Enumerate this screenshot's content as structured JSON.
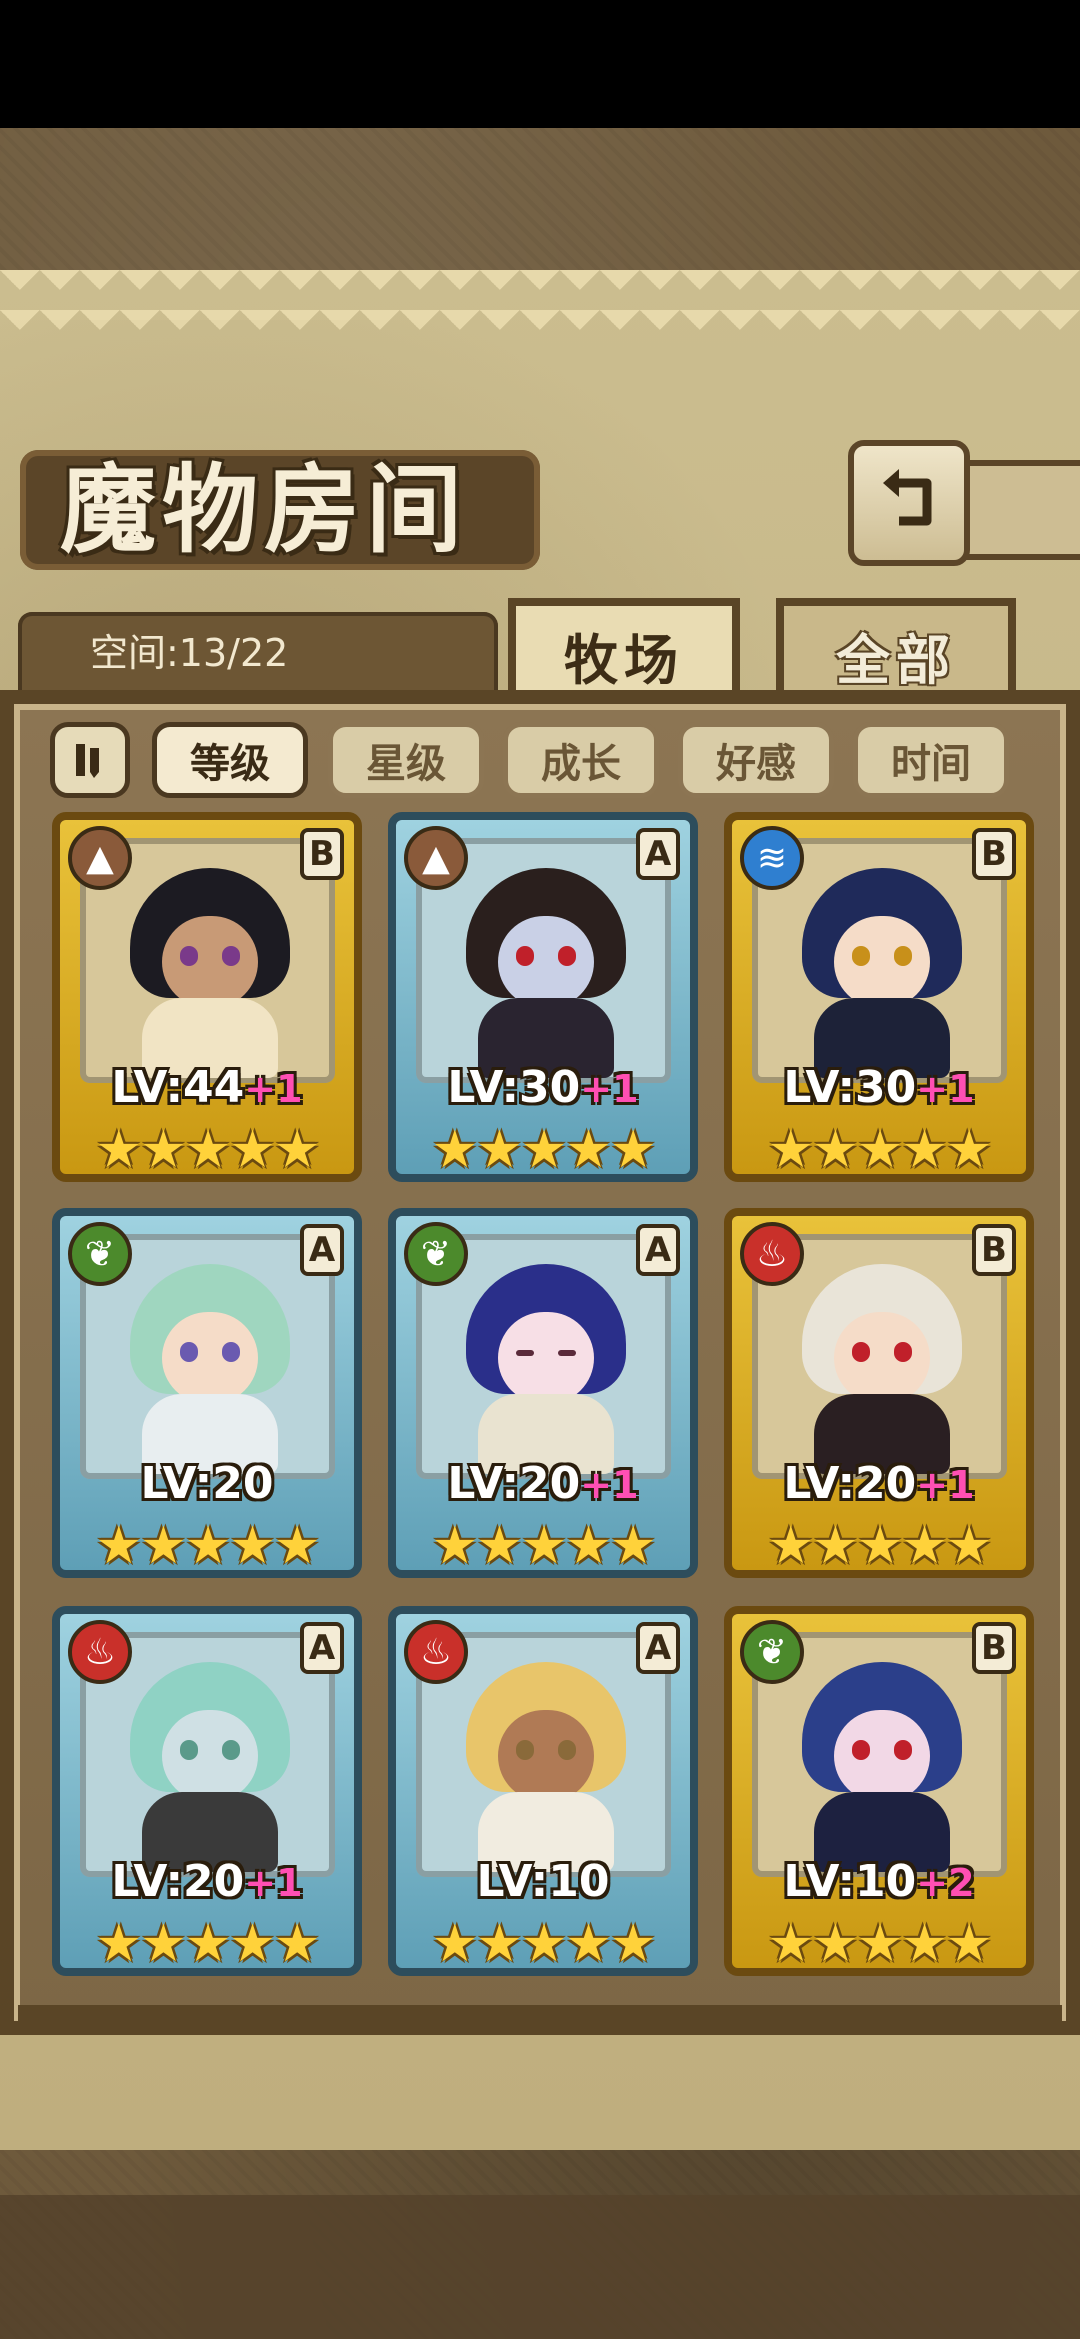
{
  "header": {
    "title": "魔物房间",
    "back_icon": "return-arrow-icon"
  },
  "space": {
    "label": "空间:13/22"
  },
  "tabs": [
    {
      "label": "牧场",
      "active": true
    },
    {
      "label": "全部",
      "active": false
    }
  ],
  "sort": {
    "pause_icon": "pause-toggle-icon",
    "options": [
      {
        "label": "等级",
        "active": true
      },
      {
        "label": "星级",
        "active": false
      },
      {
        "label": "成长",
        "active": false
      },
      {
        "label": "好感",
        "active": false
      },
      {
        "label": "时间",
        "active": false
      }
    ]
  },
  "monsters": [
    {
      "element": "earth",
      "element_icon": "mountain-icon",
      "rank": "B",
      "frame": "gold",
      "level": "LV:44",
      "bonus": "+1",
      "stars": 5,
      "star_text": "★★★★★"
    },
    {
      "element": "earth",
      "element_icon": "mountain-icon",
      "rank": "A",
      "frame": "blue",
      "level": "LV:30",
      "bonus": "+1",
      "stars": 5,
      "star_text": "★★★★★"
    },
    {
      "element": "water",
      "element_icon": "wave-icon",
      "rank": "B",
      "frame": "gold",
      "level": "LV:30",
      "bonus": "+1",
      "stars": 5,
      "star_text": "★★★★★"
    },
    {
      "element": "wind",
      "element_icon": "leaf-icon",
      "rank": "A",
      "frame": "blue",
      "level": "LV:20",
      "bonus": "",
      "stars": 5,
      "star_text": "★★★★★"
    },
    {
      "element": "wind",
      "element_icon": "leaf-icon",
      "rank": "A",
      "frame": "blue",
      "level": "LV:20",
      "bonus": "+1",
      "stars": 5,
      "star_text": "★★★★★"
    },
    {
      "element": "fire",
      "element_icon": "flame-icon",
      "rank": "B",
      "frame": "gold",
      "level": "LV:20",
      "bonus": "+1",
      "stars": 5,
      "star_text": "★★★★★"
    },
    {
      "element": "fire",
      "element_icon": "flame-icon",
      "rank": "A",
      "frame": "blue",
      "level": "LV:20",
      "bonus": "+1",
      "stars": 5,
      "star_text": "★★★★★"
    },
    {
      "element": "fire",
      "element_icon": "flame-icon",
      "rank": "A",
      "frame": "blue",
      "level": "LV:10",
      "bonus": "",
      "stars": 5,
      "star_text": "★★★★★"
    },
    {
      "element": "wind",
      "element_icon": "leaf-icon",
      "rank": "B",
      "frame": "gold",
      "level": "LV:10",
      "bonus": "+2",
      "stars": 5,
      "star_text": "★★★★★"
    }
  ],
  "colors": {
    "earth": "#8a5a3a",
    "water": "#2f7fd0",
    "wind": "#4c8a2c",
    "fire": "#c9302a",
    "gold_frame": "#e2b62c",
    "blue_frame": "#7fbcd0",
    "bonus": "#ff4fb3"
  }
}
